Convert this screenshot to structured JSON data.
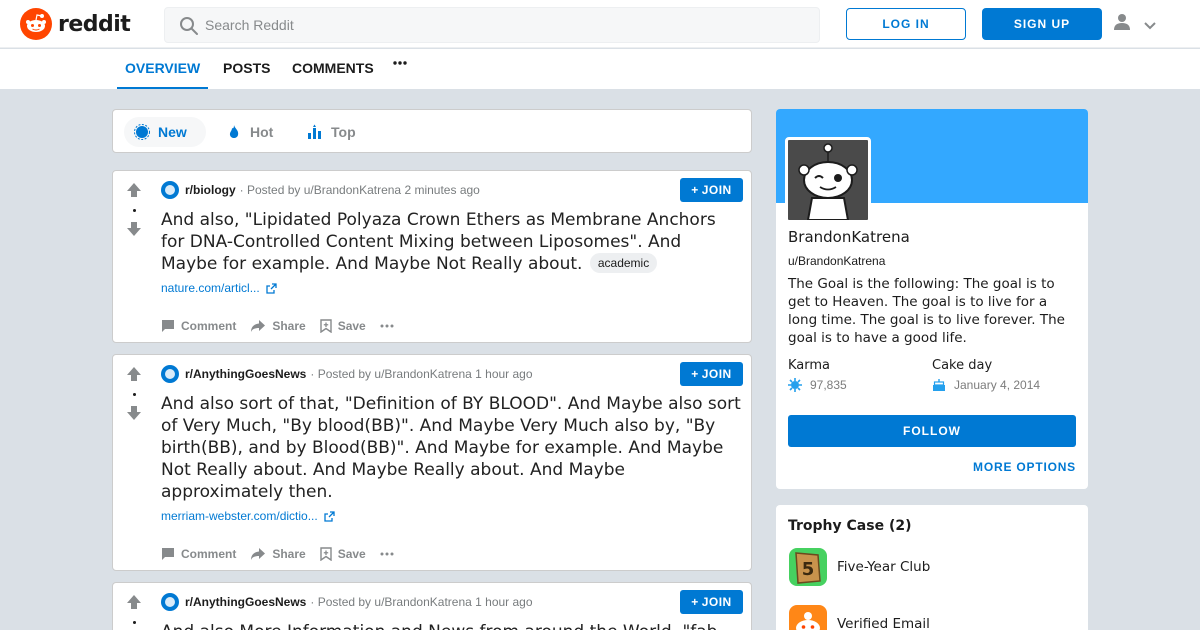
{
  "header": {
    "logo_text": "reddit",
    "search_placeholder": "Search Reddit",
    "login_label": "LOG IN",
    "signup_label": "SIGN UP"
  },
  "nav": {
    "tabs": [
      {
        "label": "OVERVIEW",
        "active": true
      },
      {
        "label": "POSTS",
        "active": false
      },
      {
        "label": "COMMENTS",
        "active": false
      }
    ]
  },
  "sort": {
    "items": [
      {
        "label": "New",
        "active": true
      },
      {
        "label": "Hot",
        "active": false
      },
      {
        "label": "Top",
        "active": false
      }
    ]
  },
  "posts": [
    {
      "subreddit": "r/biology",
      "posted_by": "· Posted by u/BrandonKatrena",
      "time": "2 minutes ago",
      "join_label": "JOIN",
      "title": "And also, \"Lipidated Polyaza Crown Ethers as Membrane Anchors for DNA-Controlled Content Mixing between Liposomes\". And Maybe for example. And Maybe Not Really about.",
      "flair": "academic",
      "link": "nature.com/articl...",
      "actions": {
        "comment": "Comment",
        "share": "Share",
        "save": "Save"
      }
    },
    {
      "subreddit": "r/AnythingGoesNews",
      "posted_by": "· Posted by u/BrandonKatrena",
      "time": "1 hour ago",
      "join_label": "JOIN",
      "title": "And also sort of that, \"Definition of BY BLOOD\". And Maybe also sort of Very Much, \"By blood(BB)\". And Maybe Very Much also by, \"By birth(BB), and by Blood(BB)\". And Maybe for example. And Maybe Not Really about. And Maybe Really about. And Maybe approximately then.",
      "link": "merriam-webster.com/dictio...",
      "actions": {
        "comment": "Comment",
        "share": "Share",
        "save": "Save"
      }
    },
    {
      "subreddit": "r/AnythingGoesNews",
      "posted_by": "· Posted by u/BrandonKatrena",
      "time": "1 hour ago",
      "join_label": "JOIN",
      "title": "And also More Information and News from around the World..\"fab"
    }
  ],
  "profile": {
    "name": "BrandonKatrena",
    "handle": "u/BrandonKatrena",
    "bio": "The Goal is the following: The goal is to get to Heaven. The goal is to live for a long time. The goal is to live forever. The goal is to have a good life.",
    "karma_label": "Karma",
    "karma_value": "97,835",
    "cakeday_label": "Cake day",
    "cakeday_value": "January 4, 2014",
    "follow_label": "FOLLOW",
    "more_options_label": "MORE OPTIONS"
  },
  "trophies": {
    "title": "Trophy Case (2)",
    "items": [
      {
        "label": "Five-Year Club",
        "icon": "five-year-club-icon"
      },
      {
        "label": "Verified Email",
        "icon": "verified-email-icon"
      }
    ]
  },
  "colors": {
    "accent": "#0079d3",
    "brand": "#ff4500",
    "banner": "#33a8ff",
    "page_bg": "#dae0e6"
  }
}
